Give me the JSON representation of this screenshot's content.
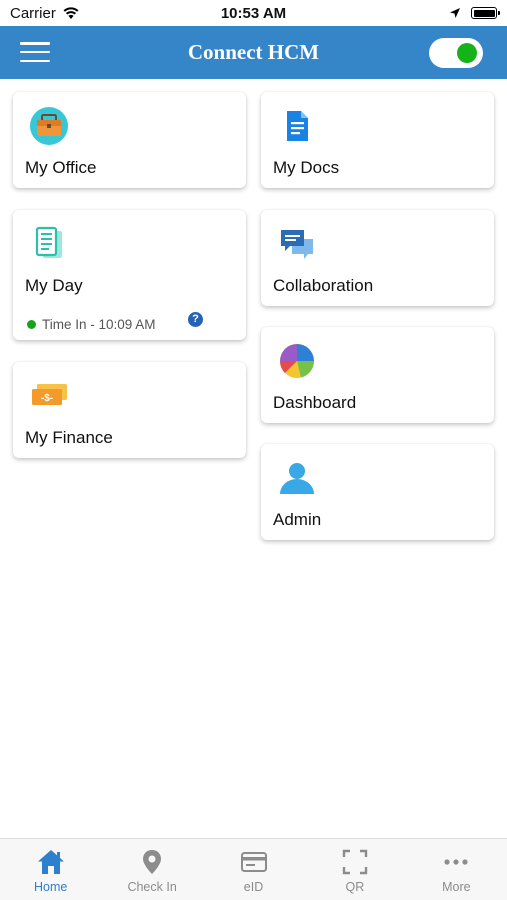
{
  "status_bar": {
    "carrier": "Carrier",
    "time": "10:53 AM"
  },
  "header": {
    "title": "Connect HCM"
  },
  "cards": {
    "my_office": {
      "label": "My Office",
      "icon": "briefcase-icon"
    },
    "my_docs": {
      "label": "My Docs",
      "icon": "document-icon"
    },
    "my_day": {
      "label": "My Day",
      "icon": "newspaper-icon",
      "status": "Time In - 10:09 AM",
      "help": "?"
    },
    "collaboration": {
      "label": "Collaboration",
      "icon": "chat-icon"
    },
    "dashboard": {
      "label": "Dashboard",
      "icon": "pie-chart-icon"
    },
    "my_finance": {
      "label": "My Finance",
      "icon": "money-icon"
    },
    "admin": {
      "label": "Admin",
      "icon": "person-icon"
    }
  },
  "tabs": [
    {
      "label": "Home",
      "icon": "home-icon",
      "active": true
    },
    {
      "label": "Check In",
      "icon": "location-pin-icon",
      "active": false
    },
    {
      "label": "eID",
      "icon": "id-card-icon",
      "active": false
    },
    {
      "label": "QR",
      "icon": "qr-scan-icon",
      "active": false
    },
    {
      "label": "More",
      "icon": "more-dots-icon",
      "active": false
    }
  ],
  "colors": {
    "header": "#3585c9",
    "accent": "#2f7fcf",
    "toggle_on": "#15b21a",
    "status_dot": "#15a31a"
  }
}
